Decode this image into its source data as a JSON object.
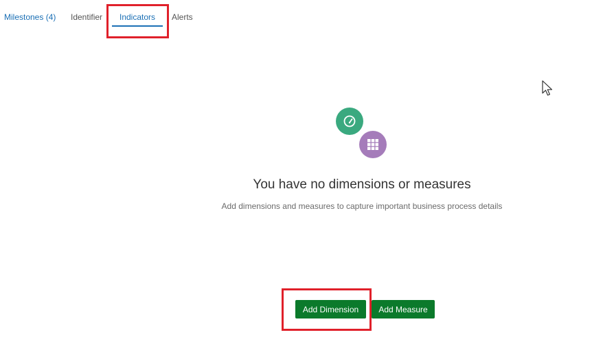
{
  "tabs": {
    "milestones": "Milestones (4)",
    "identifier": "Identifier",
    "indicators": "Indicators",
    "alerts": "Alerts",
    "active": "Indicators"
  },
  "empty_state": {
    "title": "You have no dimensions or measures",
    "description": "Add dimensions and measures to capture important business process details",
    "icons": [
      "gauge-icon",
      "grid-icon"
    ]
  },
  "actions": {
    "add_dimension": "Add Dimension",
    "add_measure": "Add Measure"
  },
  "colors": {
    "tab_active": "#1a6fb5",
    "highlight": "#e0202a",
    "gauge_circle": "#3aa97f",
    "grid_circle": "#a57cba",
    "button": "#0b7a2b"
  }
}
